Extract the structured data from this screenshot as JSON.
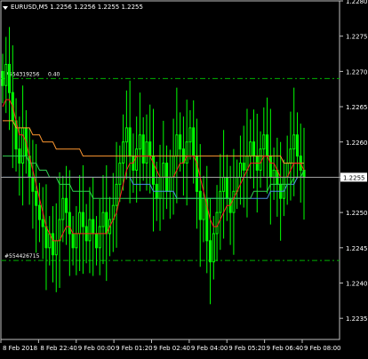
{
  "symbol_header": "EURUSD,M5 1.2256 1.2256 1.2255 1.2255",
  "colors": {
    "background": "#000000",
    "frame": "#c0c0c0",
    "text": "#ffffff",
    "candle": "#00ff00",
    "level_line": "#00b000",
    "ma_red": "#ff2020",
    "ma_orange": "#ff9830",
    "ma_green": "#30d050",
    "ma_blue": "#4a90e0",
    "price_line": "#a0a0a0"
  },
  "chart_data": {
    "type": "candlestick",
    "title": "EURUSD,M5",
    "ohlc_text": "1.2256 1.2256 1.2255 1.2255",
    "ylim": [
      1.2232,
      1.228
    ],
    "y_ticks": [
      "1.2280",
      "1.2275",
      "1.2270",
      "1.2265",
      "1.2260",
      "1.2255",
      "1.2250",
      "1.2245",
      "1.2240",
      "1.2235"
    ],
    "current_price": "1.2255",
    "x_ticks": [
      "8 Feb 2018",
      "8 Feb 22:40",
      "9 Feb 00:00",
      "9 Feb 01:20",
      "9 Feb 02:40",
      "9 Feb 04:00",
      "9 Feb 05:20",
      "9 Feb 06:40",
      "9 Feb 08:00"
    ],
    "orders": [
      {
        "label": "#554319256",
        "detail": "0.40",
        "price": 1.2269
      },
      {
        "label": "#554426715",
        "detail": "",
        "price": 1.22432
      }
    ],
    "closes": [
      1.2268,
      1.2271,
      1.2267,
      1.2263,
      1.2259,
      1.2257,
      1.2262,
      1.2258,
      1.2255,
      1.2253,
      1.2251,
      1.2249,
      1.2248,
      1.2245,
      1.2247,
      1.2244,
      1.2246,
      1.2249,
      1.2252,
      1.225,
      1.2247,
      1.2245,
      1.2247,
      1.225,
      1.2248,
      1.2246,
      1.2249,
      1.2247,
      1.2245,
      1.2248,
      1.225,
      1.2247,
      1.2249,
      1.2251,
      1.2254,
      1.2257,
      1.226,
      1.2262,
      1.2258,
      1.2256,
      1.2259,
      1.2261,
      1.2257,
      1.226,
      1.2258,
      1.2254,
      1.2252,
      1.2255,
      1.2257,
      1.2253,
      1.2255,
      1.2258,
      1.2261,
      1.2259,
      1.2257,
      1.226,
      1.2262,
      1.2258,
      1.2253,
      1.2249,
      1.2252,
      1.2246,
      1.2243,
      1.2247,
      1.225,
      1.2253,
      1.2255,
      1.2252,
      1.225,
      1.2253,
      1.2255,
      1.2257,
      1.2256,
      1.2258,
      1.226,
      1.2258,
      1.2256,
      1.2259,
      1.2261,
      1.2258,
      1.2255,
      1.2256,
      1.2254,
      1.2252,
      1.2255,
      1.2257,
      1.2259,
      1.2261,
      1.2258,
      1.2256,
      1.2255
    ],
    "ma_red": [
      1.2265,
      1.2266,
      1.2266,
      1.2265,
      1.2263,
      1.2261,
      1.2261,
      1.226,
      1.2258,
      1.2256,
      1.2254,
      1.2252,
      1.225,
      1.2248,
      1.2247,
      1.2246,
      1.2246,
      1.2246,
      1.2247,
      1.2248,
      1.2248,
      1.2247,
      1.2247,
      1.2247,
      1.2247,
      1.2247,
      1.2247,
      1.2247,
      1.2247,
      1.2247,
      1.2247,
      1.2247,
      1.2248,
      1.2249,
      1.225,
      1.2252,
      1.2254,
      1.2256,
      1.2257,
      1.2257,
      1.2258,
      1.2258,
      1.2258,
      1.2258,
      1.2258,
      1.2257,
      1.2256,
      1.2255,
      1.2255,
      1.2255,
      1.2255,
      1.2255,
      1.2256,
      1.2257,
      1.2257,
      1.2258,
      1.2258,
      1.2258,
      1.2257,
      1.2255,
      1.2253,
      1.2251,
      1.2249,
      1.2248,
      1.2248,
      1.2249,
      1.225,
      1.2251,
      1.2251,
      1.2252,
      1.2253,
      1.2254,
      1.2255,
      1.2256,
      1.2257,
      1.2257,
      1.2257,
      1.2257,
      1.2258,
      1.2258,
      1.2257,
      1.2257,
      1.2256,
      1.2255,
      1.2255,
      1.2255,
      1.2256,
      1.2257,
      1.2257,
      1.2257,
      1.2256
    ],
    "ma_orange": [
      1.2263,
      1.2263,
      1.2263,
      1.2263,
      1.2262,
      1.2262,
      1.2262,
      1.2262,
      1.2262,
      1.2261,
      1.2261,
      1.2261,
      1.226,
      1.226,
      1.226,
      1.226,
      1.2259,
      1.2259,
      1.2259,
      1.2259,
      1.2259,
      1.2259,
      1.2259,
      1.2259,
      1.2258,
      1.2258,
      1.2258,
      1.2258,
      1.2258,
      1.2258,
      1.2258,
      1.2258,
      1.2258,
      1.2258,
      1.2258,
      1.2258,
      1.2258,
      1.2258,
      1.2258,
      1.2258,
      1.2258,
      1.2258,
      1.2258,
      1.2258,
      1.2258,
      1.2258,
      1.2258,
      1.2258,
      1.2258,
      1.2258,
      1.2258,
      1.2258,
      1.2258,
      1.2258,
      1.2258,
      1.2258,
      1.2258,
      1.2258,
      1.2258,
      1.2258,
      1.2258,
      1.2258,
      1.2258,
      1.2258,
      1.2258,
      1.2258,
      1.2258,
      1.2258,
      1.2258,
      1.2258,
      1.2258,
      1.2258,
      1.2258,
      1.2258,
      1.2258,
      1.2258,
      1.2258,
      1.2258,
      1.2258,
      1.2258,
      1.2258,
      1.2258,
      1.2258,
      1.2258,
      1.2257,
      1.2257,
      1.2257,
      1.2257,
      1.2257,
      1.2257,
      1.2257
    ],
    "ma_green": [
      1.2258,
      1.2258,
      1.2258,
      1.2258,
      1.2258,
      1.2258,
      1.2258,
      1.2258,
      1.2257,
      1.2257,
      1.2257,
      1.2256,
      1.2256,
      1.2256,
      1.2255,
      1.2255,
      1.2255,
      1.2254,
      1.2254,
      1.2254,
      1.2254,
      1.2253,
      1.2253,
      1.2253,
      1.2253,
      1.2253,
      1.2253,
      1.2252,
      1.2252,
      1.2252,
      1.2252,
      1.2252,
      1.2252,
      1.2252,
      1.2252,
      1.2252,
      1.2252,
      1.2252,
      1.2252,
      1.2252,
      1.2252,
      1.2252,
      1.2252,
      1.2252,
      1.2252,
      1.2252,
      1.2252,
      1.2252,
      1.2252,
      1.2252,
      1.2252,
      1.2252,
      1.2252,
      1.2252,
      1.2252,
      1.2252,
      1.2252,
      1.2252,
      1.2252,
      1.2252,
      1.2252,
      1.2252,
      1.2252,
      1.2252,
      1.2252,
      1.2252,
      1.2252,
      1.2252,
      1.2252,
      1.2252,
      1.2252,
      1.2252,
      1.2252,
      1.2252,
      1.2252,
      1.2253,
      1.2253,
      1.2253,
      1.2253,
      1.2253,
      1.2254,
      1.2254,
      1.2254,
      1.2254,
      1.2254,
      1.2254,
      1.2254,
      1.2255,
      1.2255,
      1.2255,
      1.2256
    ],
    "ma_blue": [
      1.2255,
      1.2255,
      1.2255,
      1.2255,
      1.2255,
      1.2255,
      1.2255,
      1.2255,
      1.2255,
      1.2255,
      1.2255,
      1.2255,
      1.2255,
      1.2255,
      1.2255,
      1.2255,
      1.2255,
      1.2255,
      1.2255,
      1.2255,
      1.2255,
      1.2255,
      1.2255,
      1.2255,
      1.2255,
      1.2255,
      1.2255,
      1.2255,
      1.2255,
      1.2255,
      1.2255,
      1.2255,
      1.2255,
      1.2255,
      1.2255,
      1.2255,
      1.2255,
      1.2255,
      1.2255,
      1.2254,
      1.2254,
      1.2254,
      1.2254,
      1.2254,
      1.2254,
      1.2253,
      1.2253,
      1.2253,
      1.2253,
      1.2253,
      1.2253,
      1.2253,
      1.2252,
      1.2252,
      1.2252,
      1.2252,
      1.2252,
      1.2252,
      1.2252,
      1.2252,
      1.2252,
      1.2252,
      1.2252,
      1.2252,
      1.2252,
      1.2252,
      1.2252,
      1.2252,
      1.2252,
      1.2252,
      1.2252,
      1.2252,
      1.2252,
      1.2252,
      1.2252,
      1.2252,
      1.2252,
      1.2252,
      1.2252,
      1.2252,
      1.2253,
      1.2253,
      1.2253,
      1.2253,
      1.2253,
      1.2254,
      1.2254,
      1.2254,
      1.2255,
      1.2255,
      1.2255
    ]
  }
}
